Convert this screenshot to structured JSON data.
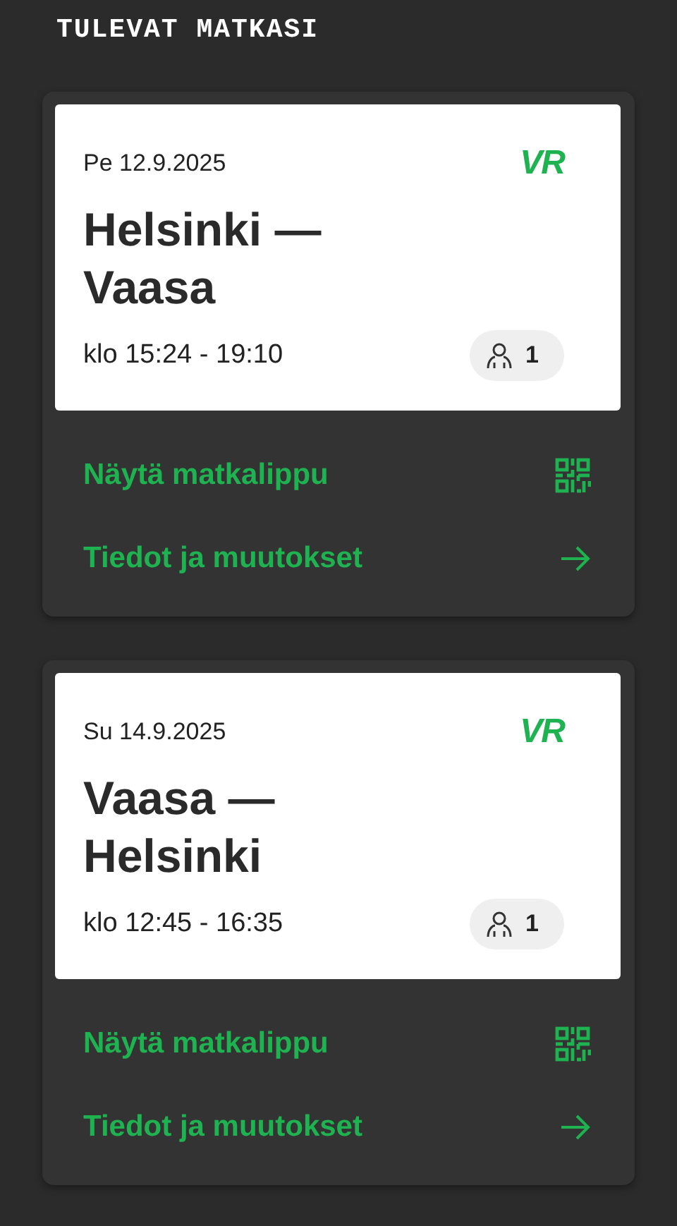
{
  "heading": "TULEVAT MATKASI",
  "trips": [
    {
      "date": "Pe 12.9.2025",
      "logo": "VR",
      "route": "Helsinki — Vaasa",
      "time": "klo 15:24 - 19:10",
      "passengers": "1",
      "actions": [
        {
          "kind": "ticket",
          "label": "Näytä matkalippu"
        },
        {
          "kind": "details",
          "label": "Tiedot ja muutokset"
        }
      ]
    },
    {
      "date": "Su 14.9.2025",
      "logo": "VR",
      "route": "Vaasa — Helsinki",
      "time": "klo 12:45 - 16:35",
      "passengers": "1",
      "actions": [
        {
          "kind": "ticket",
          "label": "Näytä matkalippu"
        },
        {
          "kind": "details",
          "label": "Tiedot ja muutokset"
        }
      ]
    }
  ]
}
